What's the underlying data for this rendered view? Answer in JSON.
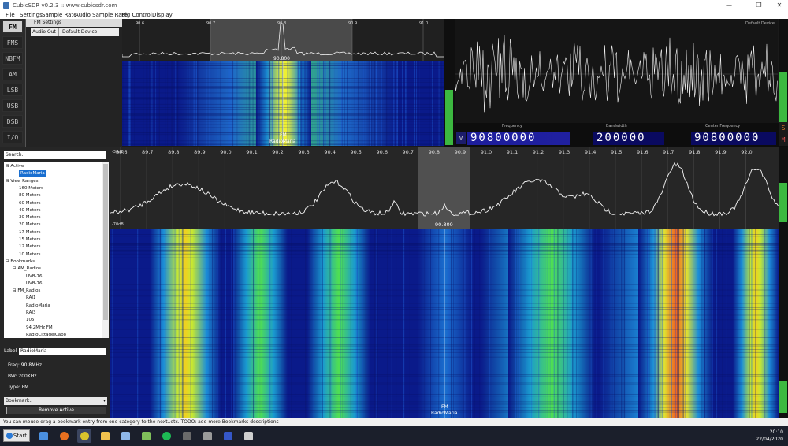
{
  "window": {
    "title": "CubicSDR v0.2.3 :: www.cubicsdr.com",
    "controls": [
      "—",
      "❐",
      "✕"
    ]
  },
  "menu": [
    "File",
    "Settings",
    "Sample Rate",
    "Audio Sample Rate",
    "Rig Control",
    "Display"
  ],
  "modes": [
    {
      "label": "FM",
      "active": true
    },
    {
      "label": "FMS",
      "active": false
    },
    {
      "label": "NBFM",
      "active": false
    },
    {
      "label": "AM",
      "active": false
    },
    {
      "label": "LSB",
      "active": false
    },
    {
      "label": "USB",
      "active": false
    },
    {
      "label": "DSB",
      "active": false
    },
    {
      "label": "I/Q",
      "active": false
    }
  ],
  "fm_settings": {
    "header": "FM Settings",
    "audio_out_key": "Audio Out",
    "audio_out_value": "Default Device"
  },
  "top_spectrum": {
    "ticks": [
      "90.6",
      "90.7",
      "90.8",
      "90.9",
      "91.0"
    ],
    "center_label": "90.800"
  },
  "top_waterfall": {
    "mode_label": "FM",
    "station_label": "RadioMaria"
  },
  "scope": {
    "device_label": "Default Device"
  },
  "readouts": {
    "frequency_label": "Frequency",
    "frequency_value": "90800000",
    "bandwidth_label": "Bandwidth",
    "bandwidth_value": "200000",
    "center_label": "Center Frequency",
    "center_value": "90800000",
    "left_letter": "V",
    "right_letter": "M",
    "s_letter": "S",
    "p_letter": "P"
  },
  "bookmarks": {
    "search_placeholder": "Search..",
    "tree": [
      {
        "text": "Active",
        "level": 0,
        "expander": "−"
      },
      {
        "text": "RadioMaria",
        "level": 1,
        "selected": true
      },
      {
        "text": "View Ranges",
        "level": 0,
        "expander": "−"
      },
      {
        "text": "160 Meters",
        "level": 1
      },
      {
        "text": "80 Meters",
        "level": 1
      },
      {
        "text": "60 Meters",
        "level": 1
      },
      {
        "text": "40 Meters",
        "level": 1
      },
      {
        "text": "30 Meters",
        "level": 1
      },
      {
        "text": "20 Meters",
        "level": 1
      },
      {
        "text": "17 Meters",
        "level": 1
      },
      {
        "text": "15 Meters",
        "level": 1
      },
      {
        "text": "12 Meters",
        "level": 1
      },
      {
        "text": "10 Meters",
        "level": 1
      },
      {
        "text": "Bookmarks",
        "level": 0,
        "expander": "−"
      },
      {
        "text": "AM_Radios",
        "level": 1,
        "expander": "−"
      },
      {
        "text": "UVB-76",
        "level": 2
      },
      {
        "text": "UVB-76",
        "level": 2
      },
      {
        "text": "FM_Radios",
        "level": 1,
        "expander": "−"
      },
      {
        "text": "RAI1",
        "level": 2
      },
      {
        "text": "RadioMaria",
        "level": 2
      },
      {
        "text": "RAI3",
        "level": 2
      },
      {
        "text": "105",
        "level": 2
      },
      {
        "text": "94.2MHz FM",
        "level": 2
      },
      {
        "text": "RadioCittadelCapo",
        "level": 2
      },
      {
        "text": "Virgin",
        "level": 2
      }
    ],
    "label_key": "Label",
    "label_value": "RadioMaria",
    "freq": "Freq: 90.8MHz",
    "bw": "BW: 200KHz",
    "type": "Type: FM",
    "select_value": "Bookmark..",
    "remove_button": "Remove Active"
  },
  "main_spectrum": {
    "db_top": "-36dB",
    "db_bottom": "-70dB",
    "ticks": [
      "89.6",
      "89.7",
      "89.8",
      "89.9",
      "90.0",
      "90.1",
      "90.2",
      "90.3",
      "90.4",
      "90.5",
      "90.6",
      "90.7",
      "90.8",
      "90.9",
      "91.0",
      "91.1",
      "91.2",
      "91.3",
      "91.4",
      "91.5",
      "91.6",
      "91.7",
      "91.8",
      "91.9",
      "92.0"
    ],
    "center_label": "90.800"
  },
  "main_waterfall": {
    "mode_label": "FM",
    "station_label": "RadioMaria"
  },
  "status": "You can mouse-drag a bookmark entry from one category to the next..etc. TODO: add more Bookmarks descriptions",
  "taskbar": {
    "start_label": "Start",
    "time": "20:10",
    "date": "22/04/2020",
    "icons": [
      {
        "name": "task-view-icon",
        "color": "#4a8fe0"
      },
      {
        "name": "firefox-icon",
        "color": "#e8701f"
      },
      {
        "name": "chrome-icon",
        "color": "#d9c32c"
      },
      {
        "name": "explorer-icon",
        "color": "#f2c14e"
      },
      {
        "name": "notepad-icon",
        "color": "#8fb7e8"
      },
      {
        "name": "image-viewer-icon",
        "color": "#7fbf5a"
      },
      {
        "name": "spotify-icon",
        "color": "#1db954"
      },
      {
        "name": "terminal-icon",
        "color": "#6a6a6a"
      },
      {
        "name": "settings-icon",
        "color": "#9a9a9a"
      },
      {
        "name": "cubicsdr-icon",
        "color": "#3557c8"
      },
      {
        "name": "network-icon",
        "color": "#cfcfcf"
      }
    ]
  },
  "colors": {
    "meter_green": "#3cb840",
    "freq_box": "#0a0a60",
    "selection": "#1a6fd0"
  }
}
